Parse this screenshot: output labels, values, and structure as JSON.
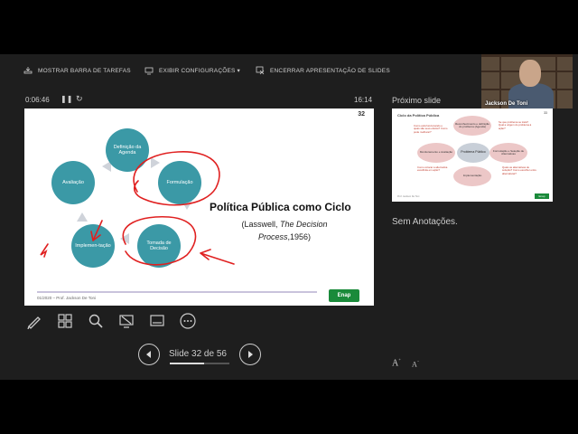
{
  "toolbar": {
    "taskbar_label": "MOSTRAR BARRA DE TAREFAS",
    "display_label": "EXIBIR CONFIGURAÇÕES ▾",
    "end_label": "ENCERRAR APRESENTAÇÃO DE SLIDES"
  },
  "webcam": {
    "name": "Jackson De Toni"
  },
  "timer": {
    "elapsed": "0:06:46",
    "clock": "16:14"
  },
  "slide": {
    "number": "32",
    "title": "Política Pública como Ciclo",
    "subtitle_line1": "(Lasswell,",
    "subtitle_italic": "The Decision Process",
    "subtitle_end": ",1956)",
    "footer": "01/2020 – Prof. Jackson De Toni",
    "logo": "Enap",
    "cycle": [
      "Definição da Agenda",
      "Formulação",
      "Tomada de Decisão",
      "Implemen-tação",
      "Avaliação"
    ]
  },
  "navigation": {
    "label": "Slide 32 de 56",
    "current": 32,
    "total": 56
  },
  "next_slide": {
    "label": "Próximo slide",
    "title": "Ciclo da Política Pública",
    "number": "33",
    "center": "Problema Público",
    "nodes": [
      "Reconhecimento e definição do problema (Agenda)",
      "Formulação e Seleção de Alternativas",
      "Implementação",
      "Monitoramento e Avaliação"
    ],
    "questions": [
      "Como está funcionando e quais são seus efeitos? Como pode melhorar?",
      "Se que problema se trata? Qual a origem do problema à ação?",
      "Quais as alternativas de solução? Como escolher entre alternativas?",
      "Como colocar a alternativa escolhida em ação?"
    ],
    "footer": "Prof. Jackson De Toni",
    "logo": "Enap"
  },
  "notes": {
    "text": "Sem Anotações."
  },
  "font_controls": {
    "increase": "A",
    "decrease": "A"
  },
  "colors": {
    "circle": "#3b99a6",
    "annotation": "#e02020",
    "background": "#1e1e1e"
  }
}
